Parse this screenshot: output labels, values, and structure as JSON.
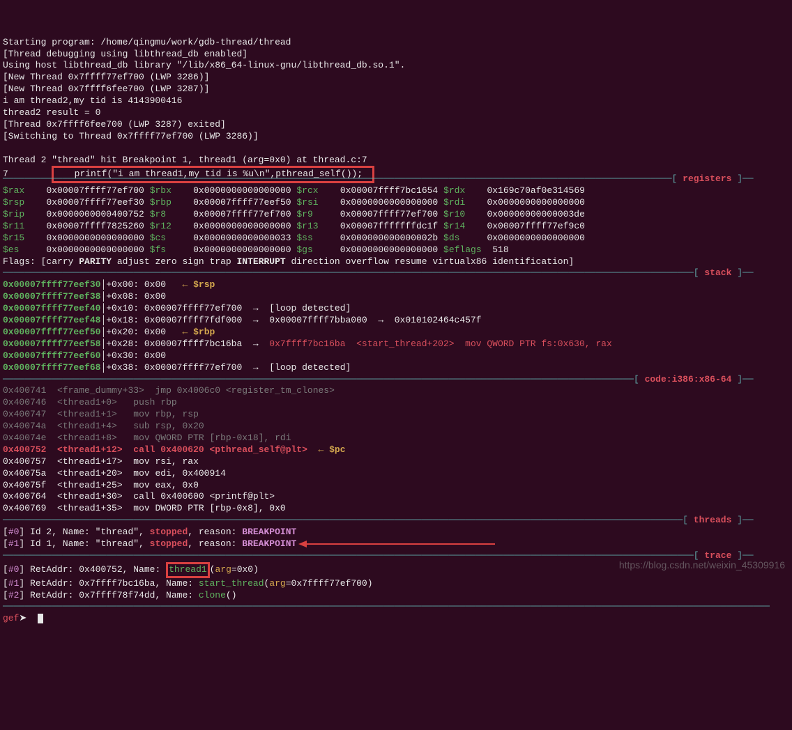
{
  "output": {
    "l0": "Starting program: /home/qingmu/work/gdb-thread/thread",
    "l1": "[Thread debugging using libthread_db enabled]",
    "l2": "Using host libthread_db library \"/lib/x86_64-linux-gnu/libthread_db.so.1\".",
    "l3": "[New Thread 0x7ffff77ef700 (LWP 3286)]",
    "l4": "[New Thread 0x7ffff6fee700 (LWP 3287)]",
    "l5": "i am thread2,my tid is 4143900416",
    "l6": "thread2 result = 0",
    "l7": "[Thread 0x7ffff6fee700 (LWP 3287) exited]",
    "l8": "[Switching to Thread 0x7ffff77ef700 (LWP 3286)]",
    "l9": "Thread 2 \"thread\" hit Breakpoint 1, thread1 (arg=0x0) at thread.c:7",
    "l10a": "7",
    "l10b": "   printf(\"i am thread1,my tid is %u\\n\",pthread_self());"
  },
  "sections": {
    "registers": "registers",
    "stack": "stack",
    "code": "code:i386:x86-64",
    "threads": "threads",
    "trace": "trace"
  },
  "regs": {
    "rax": "$rax",
    "raxv": "0x00007ffff77ef700",
    "rbx": "$rbx",
    "rbxv": "0x0000000000000000",
    "rcx": "$rcx",
    "rcxv": "0x00007ffff7bc1654",
    "rdx": "$rdx",
    "rdxv": "0x169c70af0e314569",
    "rsp": "$rsp",
    "rspv": "0x00007ffff77eef30",
    "rbp": "$rbp",
    "rbpv": "0x00007ffff77eef50",
    "rsi": "$rsi",
    "rsiv": "0x0000000000000000",
    "rdi": "$rdi",
    "rdiv": "0x0000000000000000",
    "rip": "$rip",
    "ripv": "0x0000000000400752",
    "r8": "$r8",
    "r8v": "0x00007ffff77ef700",
    "r9": "$r9",
    "r9v": "0x00007ffff77ef700",
    "r10": "$r10",
    "r10v": "0x00000000000003de",
    "r11": "$r11",
    "r11v": "0x00007ffff7825260",
    "r12": "$r12",
    "r12v": "0x0000000000000000",
    "r13": "$r13",
    "r13v": "0x00007fffffffdc1f",
    "r14": "$r14",
    "r14v": "0x00007ffff77ef9c0",
    "r15": "$r15",
    "r15v": "0x0000000000000000",
    "cs": "$cs",
    "csv": "0x0000000000000033",
    "ss": "$ss",
    "ssv": "0x000000000000002b",
    "ds": "$ds",
    "dsv": "0x0000000000000000",
    "es": "$es",
    "esv": "0x0000000000000000",
    "fs": "$fs",
    "fsv": "0x0000000000000000",
    "gs": "$gs",
    "gsv": "0x0000000000000000",
    "eflags": "$eflags",
    "efv": "518"
  },
  "flags": {
    "pre": "Flags: [",
    "carry": "carry ",
    "parity": "PARITY",
    "mid": " adjust zero sign trap ",
    "int": "INTERRUPT",
    "post": " direction overflow resume virtualx86 identification]"
  },
  "stack": {
    "a0": "0x00007ffff77eef30",
    "o0": "+0x00: ",
    "v0": "0x00",
    "m0": "  ← $rsp",
    "a1": "0x00007ffff77eef38",
    "o1": "+0x08: ",
    "v1": "0x00",
    "a2": "0x00007ffff77eef40",
    "o2": "+0x10: ",
    "v2": "0x00007ffff77ef700  →  [loop detected]",
    "a3": "0x00007ffff77eef48",
    "o3": "+0x18: ",
    "v3": "0x00007ffff7fdf000  →  0x00007ffff7bba000  →  0x010102464c457f",
    "a4": "0x00007ffff77eef50",
    "o4": "+0x20: ",
    "v4": "0x00",
    "m4": "  ← $rbp",
    "a5": "0x00007ffff77eef58",
    "o5": "+0x28: ",
    "v5": "0x00007ffff7bc16ba  →  ",
    "v5b": "0x7ffff7bc16ba  <start_thread+202>  mov QWORD PTR fs:0x630, rax",
    "a6": "0x00007ffff77eef60",
    "o6": "+0x30: ",
    "v6": "0x00",
    "a7": "0x00007ffff77eef68",
    "o7": "+0x38: ",
    "v7": "0x00007ffff77ef700  →  [loop detected]"
  },
  "code": {
    "a0": "0x400741",
    "s0": "<frame_dummy+33>",
    "i0": "jmp 0x4006c0 <register_tm_clones>",
    "a1": "0x400746",
    "s1": "<thread1+0>",
    "i1": "push rbp",
    "a2": "0x400747",
    "s2": "<thread1+1>",
    "i2": "mov rbp, rsp",
    "a3": "0x40074a",
    "s3": "<thread1+4>",
    "i3": "sub rsp, 0x20",
    "a4": "0x40074e",
    "s4": "<thread1+8>",
    "i4": "mov QWORD PTR [rbp-0x18], rdi",
    "a5": "0x400752",
    "s5": "<thread1+12>",
    "i5": "call 0x400620 <pthread_self@plt>",
    "m5": "  ← $pc",
    "a6": "0x400757",
    "s6": "<thread1+17>",
    "i6": "mov rsi, rax",
    "a7": "0x40075a",
    "s7": "<thread1+20>",
    "i7": "mov edi, 0x400914",
    "a8": "0x40075f",
    "s8": "<thread1+25>",
    "i8": "mov eax, 0x0",
    "a9": "0x400764",
    "s9": "<thread1+30>",
    "i9": "call 0x400600 <printf@plt>",
    "a10": "0x400769",
    "s10": "<thread1+35>",
    "i10": "mov DWORD PTR [rbp-0x8], 0x0"
  },
  "threads": {
    "t0a": "#0",
    "t0b": "] Id 2, Name: \"thread\", ",
    "t0c": "stopped",
    "t0d": ", reason: ",
    "t0e": "BREAKPOINT",
    "t1a": "#1",
    "t1b": "] Id 1, Name: \"thread\", ",
    "t1c": "stopped",
    "t1d": ", reason: ",
    "t1e": "BREAKPOINT"
  },
  "trace": {
    "r0a": "#0",
    "r0b": "] RetAddr: 0x400752, Name: ",
    "r0c": "thread1",
    "r0d": "(",
    "r0e": "arg",
    "r0f": "=0x0)",
    "r1a": "#1",
    "r1b": "] RetAddr: 0x7ffff7bc16ba, Name: ",
    "r1c": "start_thread",
    "r1d": "(",
    "r1e": "arg",
    "r1f": "=0x7ffff77ef700)",
    "r2a": "#2",
    "r2b": "] RetAddr: 0x7ffff78f74dd, Name: ",
    "r2c": "clone",
    "r2d": "()"
  },
  "prompt": {
    "g": "gef"
  },
  "wm": "https://blog.csdn.net/weixin_45309916"
}
